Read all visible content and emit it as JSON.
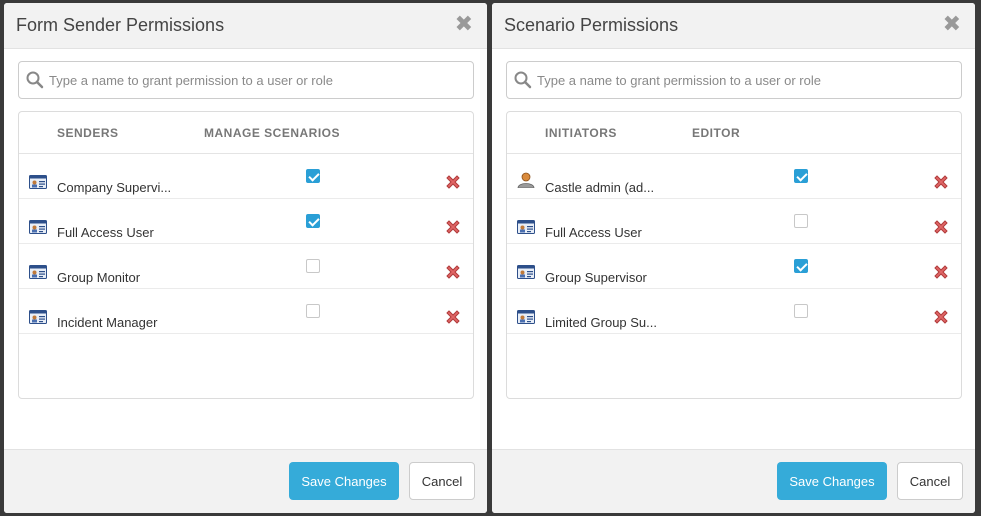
{
  "dialogs": [
    {
      "title": "Form Sender Permissions",
      "close_glyph": "✖",
      "search": {
        "placeholder": "Type a name to grant permission to a user or role",
        "value": ""
      },
      "columns": [
        "SENDERS",
        "MANAGE SCENARIOS"
      ],
      "rows": [
        {
          "icon": "role-card-icon",
          "label": "Company Supervi...",
          "checked": true
        },
        {
          "icon": "role-card-icon",
          "label": "Full Access User",
          "checked": true
        },
        {
          "icon": "role-card-icon",
          "label": "Group Monitor",
          "checked": false
        },
        {
          "icon": "role-card-icon",
          "label": "Incident Manager",
          "checked": false
        }
      ],
      "save_label": "Save Changes",
      "cancel_label": "Cancel"
    },
    {
      "title": "Scenario Permissions",
      "close_glyph": "✖",
      "search": {
        "placeholder": "Type a name to grant permission to a user or role",
        "value": ""
      },
      "columns": [
        "INITIATORS",
        "EDITOR"
      ],
      "rows": [
        {
          "icon": "user-icon",
          "label": "Castle admin (ad...",
          "checked": true
        },
        {
          "icon": "role-card-icon",
          "label": "Full Access User",
          "checked": false
        },
        {
          "icon": "role-card-icon",
          "label": "Group Supervisor",
          "checked": true
        },
        {
          "icon": "role-card-icon",
          "label": "Limited Group Su...",
          "checked": false
        }
      ],
      "save_label": "Save Changes",
      "cancel_label": "Cancel"
    }
  ],
  "colors": {
    "accent": "#35abd9",
    "checkbox_on": "#2a9fd6",
    "delete": "#d9534f"
  }
}
